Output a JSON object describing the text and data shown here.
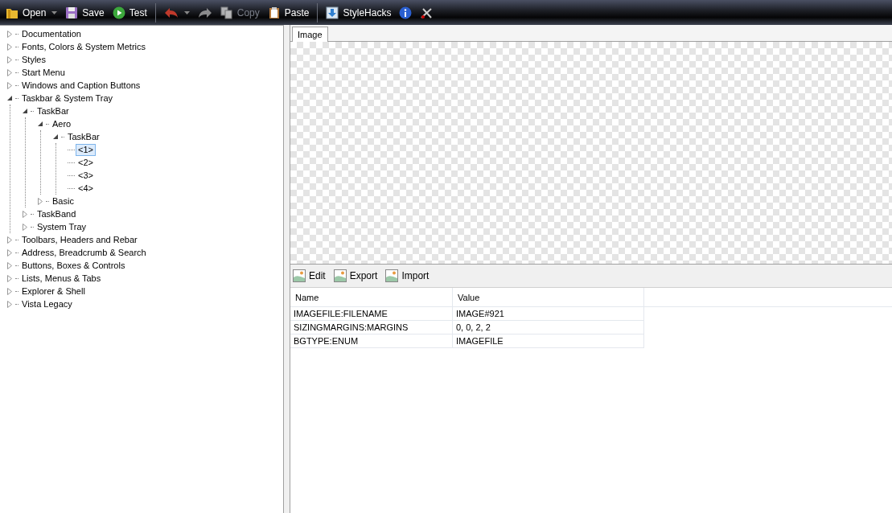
{
  "toolbar": [
    {
      "kind": "button",
      "label": "Open",
      "dropdown": true,
      "disabled": false
    },
    {
      "kind": "button",
      "label": "Save",
      "dropdown": false,
      "disabled": false
    },
    {
      "kind": "button",
      "label": "Test",
      "dropdown": false,
      "disabled": false
    },
    {
      "kind": "separator"
    },
    {
      "kind": "button",
      "dropdown": true,
      "disabled": false
    },
    {
      "kind": "button",
      "dropdown": false,
      "disabled": true
    },
    {
      "kind": "button",
      "label": "Copy",
      "dropdown": false,
      "disabled": true
    },
    {
      "kind": "button",
      "label": "Paste",
      "dropdown": false,
      "disabled": false
    },
    {
      "kind": "separator"
    },
    {
      "kind": "button",
      "label": "StyleHacks",
      "dropdown": false,
      "disabled": false
    },
    {
      "kind": "button",
      "dropdown": false,
      "disabled": false
    },
    {
      "kind": "button",
      "dropdown": false,
      "disabled": false
    }
  ],
  "tree": [
    {
      "label": "Documentation",
      "expanded": false,
      "selected": false
    },
    {
      "label": "Fonts, Colors & System Metrics",
      "expanded": false,
      "selected": false
    },
    {
      "label": "Styles",
      "expanded": false,
      "selected": false
    },
    {
      "label": "Start Menu",
      "expanded": false,
      "selected": false
    },
    {
      "label": "Windows and Caption Buttons",
      "expanded": false,
      "selected": false
    },
    {
      "label": "Taskbar & System Tray",
      "expanded": true,
      "selected": false,
      "children": [
        {
          "label": "TaskBar",
          "expanded": true,
          "selected": false,
          "children": [
            {
              "label": "Aero",
              "expanded": true,
              "selected": false,
              "children": [
                {
                  "label": "TaskBar",
                  "expanded": true,
                  "selected": false,
                  "children": [
                    {
                      "label": "<1>",
                      "selected": true
                    },
                    {
                      "label": "<2>",
                      "selected": false
                    },
                    {
                      "label": "<3>",
                      "selected": false
                    },
                    {
                      "label": "<4>",
                      "selected": false
                    }
                  ]
                }
              ]
            },
            {
              "label": "Basic",
              "expanded": false,
              "selected": false
            }
          ]
        },
        {
          "label": "TaskBand",
          "expanded": false,
          "selected": false
        },
        {
          "label": "System Tray",
          "expanded": false,
          "selected": false
        }
      ]
    },
    {
      "label": "Toolbars, Headers and Rebar",
      "expanded": false,
      "selected": false
    },
    {
      "label": "Address, Breadcrumb & Search",
      "expanded": false,
      "selected": false
    },
    {
      "label": "Buttons, Boxes & Controls",
      "expanded": false,
      "selected": false
    },
    {
      "label": "Lists, Menus & Tabs",
      "expanded": false,
      "selected": false
    },
    {
      "label": "Explorer & Shell",
      "expanded": false,
      "selected": false
    },
    {
      "label": "Vista Legacy",
      "expanded": false,
      "selected": false
    }
  ],
  "tabs": [
    {
      "label": "Image",
      "selected": true
    }
  ],
  "image_toolbar": [
    "Edit",
    "Export",
    "Import"
  ],
  "table": {
    "columns": [
      "Name",
      "Value"
    ],
    "rows": [
      [
        "IMAGEFILE:FILENAME",
        "IMAGE#921"
      ],
      [
        "SIZINGMARGINS:MARGINS",
        "0, 0, 2, 2"
      ],
      [
        "BGTYPE:ENUM",
        "IMAGEFILE"
      ]
    ]
  }
}
